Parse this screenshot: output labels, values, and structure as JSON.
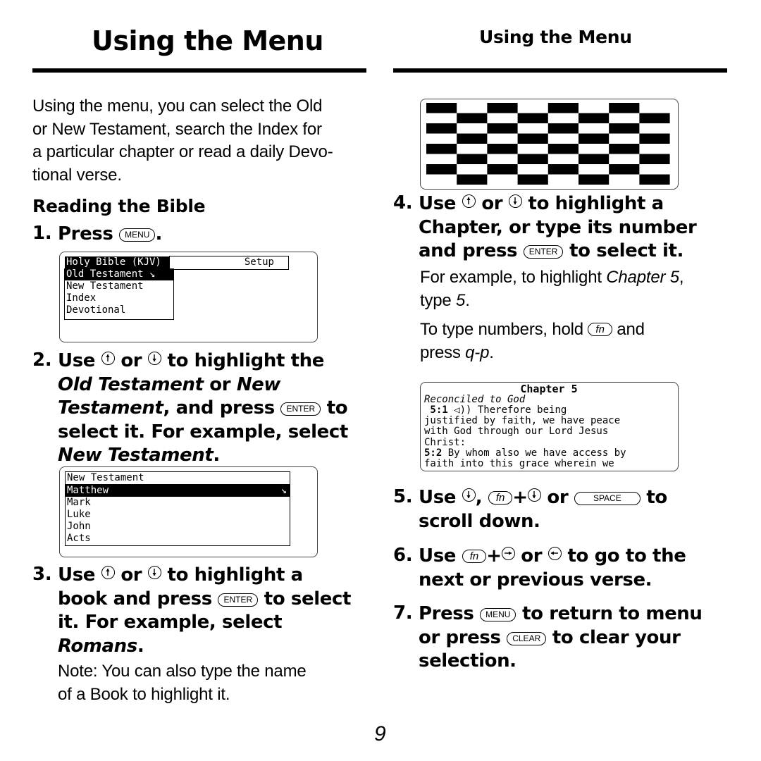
{
  "left_title": "Using the Menu",
  "right_header": "Using the Menu",
  "intro": [
    "Using the menu, you can select the Old",
    "or New Testament, search the Index for",
    "a particular chapter or read a daily Devo-",
    "tional verse."
  ],
  "section_heading": "Reading the Bible",
  "menu_screen": {
    "header_left": "Holy Bible (KJV)",
    "header_right": "Setup",
    "items": [
      "Old Testament ↘",
      "New Testament",
      "Index",
      "Devotional"
    ],
    "selected_index": 0
  },
  "book_screen": {
    "header": "New Testament",
    "items": [
      "Matthew",
      "Mark",
      "Luke",
      "John",
      "Acts"
    ],
    "selected_index": 0,
    "selected_marker": "↘"
  },
  "chapter_screen": {
    "title": "Chapter 5",
    "subtitle": "Reconciled to God",
    "lines": [
      [
        {
          "b": " 5:1 "
        },
        {
          "t": "◁)) Therefore being"
        }
      ],
      [
        {
          "t": "justified by faith, we have peace"
        }
      ],
      [
        {
          "t": "with God through our Lord Jesus"
        }
      ],
      [
        {
          "t": "Christ:"
        }
      ],
      [
        {
          "b": "5:2"
        },
        {
          "t": " By whom also we have access by"
        }
      ],
      [
        {
          "t": "faith into this grace wherein we"
        }
      ]
    ]
  },
  "loading_screen": {
    "pattern": "checkerboard"
  },
  "steps": [
    {
      "num": "1.",
      "lines": [
        [
          {
            "t": "Press "
          },
          {
            "key": "MENU"
          },
          {
            "t": "."
          }
        ]
      ]
    },
    {
      "num": "2.",
      "lines": [
        [
          {
            "t": "Use "
          },
          {
            "arrow": "up"
          },
          {
            "t": " or "
          },
          {
            "arrow": "down"
          },
          {
            "t": " to highlight the"
          }
        ],
        [
          {
            "em": "Old Testament"
          },
          {
            "t": " or "
          },
          {
            "em": "New"
          }
        ],
        [
          {
            "em": "Testament"
          },
          {
            "t": ", and press "
          },
          {
            "key": "ENTER"
          },
          {
            "t": " to"
          }
        ],
        [
          {
            "t": "select it. For example, select"
          }
        ],
        [
          {
            "em": "New Testament"
          },
          {
            "t": "."
          }
        ]
      ]
    },
    {
      "num": "3.",
      "lines": [
        [
          {
            "t": "Use "
          },
          {
            "arrow": "up"
          },
          {
            "t": " or "
          },
          {
            "arrow": "down"
          },
          {
            "t": " to highlight a"
          }
        ],
        [
          {
            "t": "book and press "
          },
          {
            "key": "ENTER"
          },
          {
            "t": " to select"
          }
        ],
        [
          {
            "t": "it. For example, select"
          }
        ],
        [
          {
            "em": "Romans"
          },
          {
            "t": "."
          }
        ]
      ]
    },
    {
      "num": "4.",
      "lines": [
        [
          {
            "t": "Use "
          },
          {
            "arrow": "up"
          },
          {
            "t": " or "
          },
          {
            "arrow": "down"
          },
          {
            "t": " to highlight a"
          }
        ],
        [
          {
            "t": "Chapter, or type its number"
          }
        ],
        [
          {
            "t": "and press "
          },
          {
            "key": "ENTER"
          },
          {
            "t": " to select it."
          }
        ]
      ]
    },
    {
      "num": "5.",
      "lines": [
        [
          {
            "t": "Use "
          },
          {
            "arrow": "down"
          },
          {
            "t": ", "
          },
          {
            "key": "fn"
          },
          {
            "t": "+"
          },
          {
            "arrow": "down"
          },
          {
            "t": " or "
          },
          {
            "key": "SPACE"
          },
          {
            "t": " to"
          }
        ],
        [
          {
            "t": "scroll down."
          }
        ]
      ]
    },
    {
      "num": "6.",
      "lines": [
        [
          {
            "t": "Use "
          },
          {
            "key": "fn"
          },
          {
            "t": "+"
          },
          {
            "arrow": "right"
          },
          {
            "t": " or "
          },
          {
            "arrow": "left"
          },
          {
            "t": " to go to the"
          }
        ],
        [
          {
            "t": "next or previous verse."
          }
        ]
      ]
    },
    {
      "num": "7.",
      "lines": [
        [
          {
            "t": "Press "
          },
          {
            "key": "MENU"
          },
          {
            "t": " to return to menu"
          }
        ],
        [
          {
            "t": "or press "
          },
          {
            "key": "CLEAR"
          },
          {
            "t": " to clear your"
          }
        ],
        [
          {
            "t": "selection."
          }
        ]
      ]
    }
  ],
  "note": [
    "Note: You can also type the name",
    "of a Book to highlight it."
  ],
  "example_chapter": [
    [
      {
        "t": "For example, to highlight "
      },
      {
        "em": "Chapter 5"
      },
      {
        "t": ","
      }
    ],
    [
      {
        "t": "type "
      },
      {
        "em": "5"
      },
      {
        "t": "."
      }
    ]
  ],
  "example_numbers": [
    [
      {
        "t": "To type numbers, hold "
      },
      {
        "key": "fn"
      },
      {
        "t": " and"
      }
    ],
    [
      {
        "t": "press "
      },
      {
        "em": "q-p"
      },
      {
        "t": "."
      }
    ]
  ],
  "page_number": "9"
}
